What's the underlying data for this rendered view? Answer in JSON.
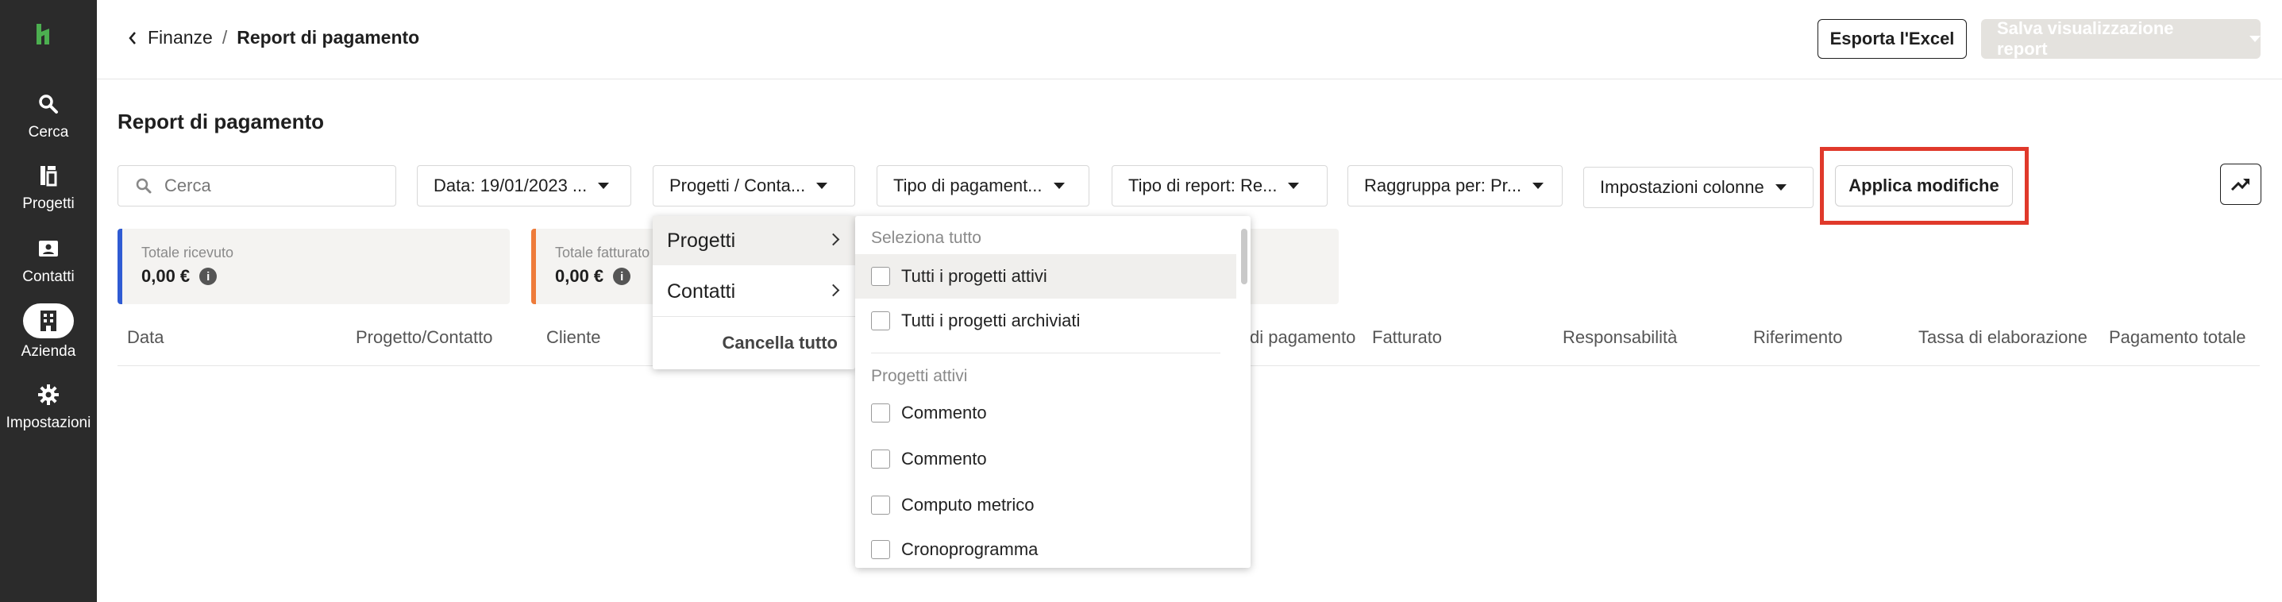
{
  "sidebar": {
    "items": [
      {
        "label": "Cerca",
        "icon": "search-icon"
      },
      {
        "label": "Progetti",
        "icon": "projects-icon"
      },
      {
        "label": "Contatti",
        "icon": "contact-card-icon"
      },
      {
        "label": "Azienda",
        "icon": "building-icon"
      },
      {
        "label": "Impostazioni",
        "icon": "gear-icon"
      }
    ],
    "active": "Azienda"
  },
  "header": {
    "breadcrumb_parent": "Finanze",
    "breadcrumb_separator": "/",
    "breadcrumb_current": "Report di pagamento",
    "export_label": "Esporta l'Excel",
    "save_view_label": "Salva visualizzazione report"
  },
  "page_title": "Report di pagamento",
  "filters": {
    "search_placeholder": "Cerca",
    "date": "Data: 19/01/2023 ...",
    "projects_contacts": "Progetti / Conta...",
    "payment_type": "Tipo di pagament...",
    "report_type": "Tipo di report: Re...",
    "group_by": "Raggruppa per: Pr...",
    "column_settings": "Impostazioni colonne",
    "apply_label": "Applica modifiche"
  },
  "cards": [
    {
      "label": "Totale ricevuto",
      "value": "0,00 €",
      "accent": "#2f5bd3"
    },
    {
      "label": "Totale fatturato",
      "value": "0,00 €",
      "accent": "#ee7b3a"
    }
  ],
  "table": {
    "columns": [
      "Data",
      "Progetto/Contatto",
      "Cliente",
      "di pagamento",
      "Fatturato",
      "Responsabilità",
      "Riferimento",
      "Tassa di elaborazione",
      "Pagamento totale"
    ]
  },
  "dropdown": {
    "categories": [
      "Progetti",
      "Contatti"
    ],
    "clear_all": "Cancella tutto",
    "select_all": "Seleziona tutto",
    "all_active": "Tutti i progetti attivi",
    "all_archived": "Tutti i progetti archiviati",
    "active_projects_header": "Progetti attivi",
    "projects": [
      "Commento",
      "Commento",
      "Computo metrico",
      "Cronoprogramma"
    ]
  },
  "colors": {
    "sidebar_bg": "#2b2b2b",
    "logo_green": "#4caf50",
    "highlight_red": "#e0392b"
  }
}
